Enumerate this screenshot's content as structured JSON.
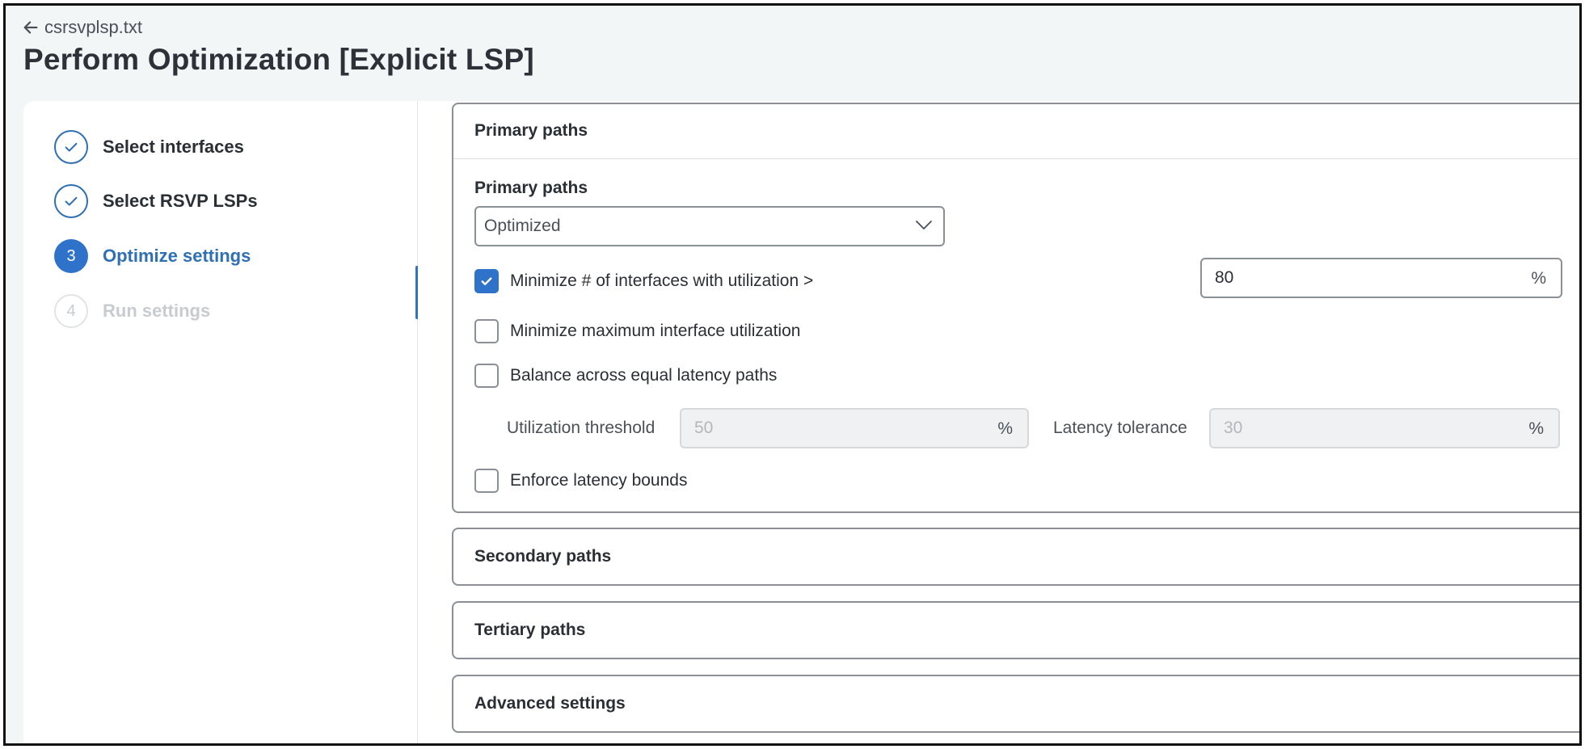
{
  "header": {
    "back_label": "csrsvplsp.txt",
    "title": "Perform Optimization [Explicit LSP]"
  },
  "steps": [
    {
      "number": "1",
      "label": "Select interfaces",
      "state": "done"
    },
    {
      "number": "2",
      "label": "Select RSVP LSPs",
      "state": "done"
    },
    {
      "number": "3",
      "label": "Optimize settings",
      "state": "active"
    },
    {
      "number": "4",
      "label": "Run settings",
      "state": "pending"
    }
  ],
  "primary_panel": {
    "title": "Primary paths",
    "field_label": "Primary paths",
    "select_value": "Optimized",
    "options": {
      "minimize_interfaces": {
        "label": "Minimize # of interfaces with utilization >",
        "checked": true,
        "value": "80",
        "unit": "%"
      },
      "minimize_max": {
        "label": "Minimize maximum interface utilization",
        "checked": false
      },
      "balance": {
        "label": "Balance across equal latency paths",
        "checked": false
      },
      "enforce": {
        "label": "Enforce latency bounds",
        "checked": false
      }
    },
    "utilization_threshold": {
      "label": "Utilization threshold",
      "placeholder": "50",
      "unit": "%"
    },
    "latency_tolerance": {
      "label": "Latency tolerance",
      "placeholder": "30",
      "unit": "%"
    }
  },
  "collapsed_panels": [
    {
      "title": "Secondary paths"
    },
    {
      "title": "Tertiary paths"
    },
    {
      "title": "Advanced settings"
    }
  ],
  "colors": {
    "accent": "#2f72c9",
    "step_done": "#2f6fb5",
    "border": "#8a9096"
  }
}
